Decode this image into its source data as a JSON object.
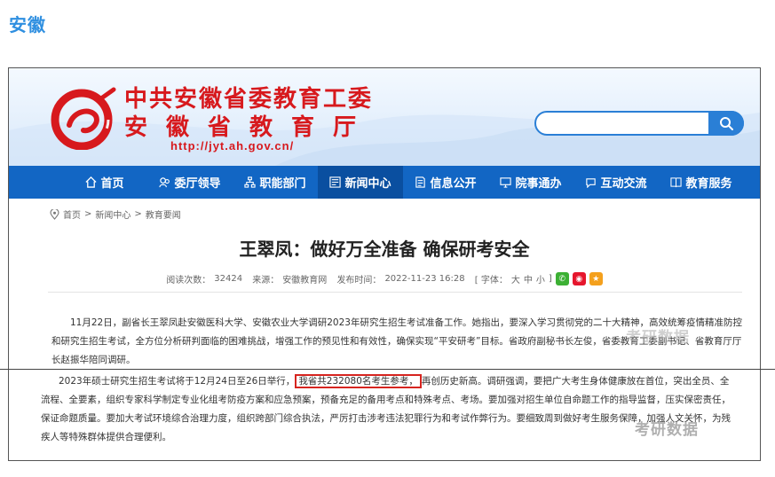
{
  "section_label": "安徽",
  "site": {
    "title_line1": "中共安徽省委教育工委",
    "title_line2": "安徽省教育厅",
    "url": "http://jyt.ah.gov.cn/",
    "search_placeholder": ""
  },
  "nav": {
    "items": [
      {
        "label": "首页",
        "icon": "home-icon"
      },
      {
        "label": "委厅领导",
        "icon": "leaders-icon"
      },
      {
        "label": "职能部门",
        "icon": "org-chart-icon"
      },
      {
        "label": "新闻中心",
        "icon": "news-icon"
      },
      {
        "label": "信息公开",
        "icon": "document-icon"
      },
      {
        "label": "院事通办",
        "icon": "monitor-icon"
      },
      {
        "label": "互动交流",
        "icon": "chat-icon"
      },
      {
        "label": "教育服务",
        "icon": "book-icon"
      }
    ],
    "active_index": 3
  },
  "breadcrumb": {
    "items": [
      "首页",
      "新闻中心",
      "教育要闻"
    ],
    "separator": ">"
  },
  "article": {
    "title": "王翠凤：做好万全准备 确保研考安全",
    "meta": {
      "views_label": "阅读次数：",
      "views": "32424",
      "source_label": "来源：",
      "source": "安徽教育网",
      "date_label": "发布时间：",
      "date": "2022-11-23 16:28",
      "font_label": "[ 字体：",
      "font_sizes": [
        "大",
        "中",
        "小"
      ],
      "font_end": "]"
    },
    "paragraph1": "11月22日，副省长王翠凤赴安徽医科大学、安徽农业大学调研2023年研究生招生考试准备工作。她指出，要深入学习贯彻党的二十大精神，高效统筹疫情精准防控和研究生招生考试，全方位分析研判面临的困难挑战，增强工作的预见性和有效性，确保实现“平安研考”目标。省政府副秘书长左俊，省委教育工委副书记、省教育厅厅长赵振华陪同调研。",
    "paragraph2_before": "2023年硕士研究生招生考试将于12月24日至26日举行，",
    "paragraph2_highlight": "我省共232080名考生参考，",
    "paragraph2_after": "再创历史新高。调研强调，要把广大考生身体健康放在首位，突出全员、全流程、全要素，组织专家科学制定专业化组考防疫方案和应急预案，预备充足的备用考点和特殊考点、考场。要加强对招生单位自命题工作的指导监督，压实保密责任，保证命题质量。要加大考试环境综合治理力度，组织跨部门综合执法，严厉打击涉考违法犯罪行为和考试作弊行为。要细致周到做好考生服务保障，加强人文关怀，为残疾人等特殊群体提供合理便利。"
  },
  "watermark": {
    "text1": "考研数据",
    "text2": "考研数据"
  },
  "colors": {
    "nav_bg": "#1266c4",
    "nav_active": "#0a4fa0",
    "title_red": "#d7191d",
    "section_blue": "#2f8fe0",
    "highlight_border": "#d6241f"
  }
}
